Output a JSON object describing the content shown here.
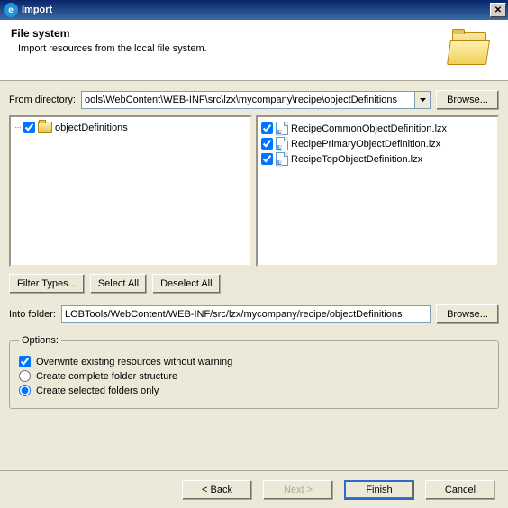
{
  "window": {
    "title": "Import"
  },
  "header": {
    "title": "File system",
    "subtitle": "Import resources from the local file system."
  },
  "fromDir": {
    "label": "From directory:",
    "value": "ools\\WebContent\\WEB-INF\\src\\lzx\\mycompany\\recipe\\objectDefinitions",
    "browse": "Browse..."
  },
  "tree": {
    "root": "objectDefinitions"
  },
  "files": [
    {
      "name": "RecipeCommonObjectDefinition.lzx",
      "checked": true
    },
    {
      "name": "RecipePrimaryObjectDefinition.lzx",
      "checked": true
    },
    {
      "name": "RecipeTopObjectDefinition.lzx",
      "checked": true
    }
  ],
  "buttons": {
    "filterTypes": "Filter Types...",
    "selectAll": "Select All",
    "deselectAll": "Deselect All"
  },
  "intoFolder": {
    "label": "Into folder:",
    "value": "LOBTools/WebContent/WEB-INF/src/lzx/mycompany/recipe/objectDefinitions",
    "browse": "Browse..."
  },
  "options": {
    "legend": "Options:",
    "overwrite": "Overwrite existing resources without warning",
    "createComplete": "Create complete folder structure",
    "createSelected": "Create selected folders only"
  },
  "footer": {
    "back": "< Back",
    "next": "Next >",
    "finish": "Finish",
    "cancel": "Cancel"
  }
}
